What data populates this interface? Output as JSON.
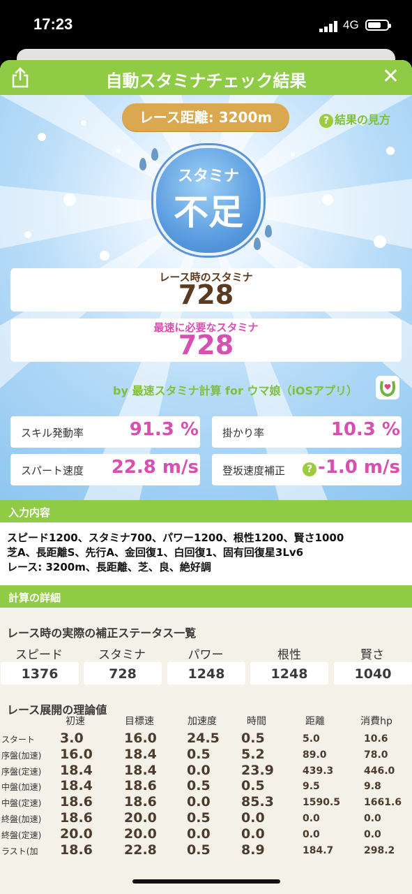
{
  "status_bar": {
    "time": "17:23",
    "network": "4G"
  },
  "header": {
    "title": "自動スタミナチェック結果",
    "share_icon": "share-icon",
    "close_icon": "close-icon",
    "close_glyph": "✕"
  },
  "race_distance": "レース距離: 3200m",
  "help_link": {
    "icon": "?",
    "label": "結果の見方"
  },
  "verdict": {
    "sub": "スタミナ",
    "main": "不足"
  },
  "race_stamina": {
    "label": "レース時のスタミナ",
    "value": "728"
  },
  "required_stamina": {
    "label": "最速に必要なスタミナ",
    "value": "728"
  },
  "credit": "by 最速スタミナ計算 for ウマ娘（iOSアプリ）",
  "metrics": {
    "skill_rate": {
      "label": "スキル発動率",
      "value": "91.3 %"
    },
    "kakari_rate": {
      "label": "掛かり率",
      "value": "10.3 %"
    },
    "spurt_speed": {
      "label": "スパート速度",
      "value": "22.8 m/s"
    },
    "slope_correction": {
      "label": "登坂速度補正",
      "value": "-1.0 m/s",
      "help": "?"
    }
  },
  "input_section": {
    "title": "入力内容",
    "lines": [
      "スピード1200、スタミナ700、パワー1200、根性1200、賢さ1000",
      "芝A、長距離S、先行A、金回復1、白回復1、固有回復星3Lv6",
      "レース: 3200m、長距離、芝、良、絶好調"
    ]
  },
  "details_section": {
    "title": "計算の詳細",
    "corrected_title": "レース時の実際の補正ステータス一覧",
    "stats": [
      {
        "label": "スピード",
        "value": "1376"
      },
      {
        "label": "スタミナ",
        "value": "728"
      },
      {
        "label": "パワー",
        "value": "1248"
      },
      {
        "label": "根性",
        "value": "1248"
      },
      {
        "label": "賢さ",
        "value": "1040"
      }
    ],
    "theory_title": "レース展開の理論値",
    "columns": [
      "初速",
      "目標速",
      "加速度",
      "時間",
      "距離",
      "消費hp"
    ],
    "rows": [
      {
        "label": "スタート",
        "values": [
          "3.0",
          "16.0",
          "24.5",
          "0.5",
          "5.0",
          "10.6"
        ]
      },
      {
        "label": "序盤(加速)",
        "values": [
          "16.0",
          "18.4",
          "0.5",
          "5.2",
          "89.0",
          "78.0"
        ]
      },
      {
        "label": "序盤(定速)",
        "values": [
          "18.4",
          "18.4",
          "0.0",
          "23.9",
          "439.3",
          "446.0"
        ]
      },
      {
        "label": "中盤(加速)",
        "values": [
          "18.4",
          "18.6",
          "0.5",
          "0.5",
          "9.5",
          "9.8"
        ]
      },
      {
        "label": "中盤(定速)",
        "values": [
          "18.6",
          "18.6",
          "0.0",
          "85.3",
          "1590.5",
          "1661.6"
        ]
      },
      {
        "label": "終盤(加速)",
        "values": [
          "18.6",
          "20.0",
          "0.5",
          "0.0",
          "0.0",
          "0.0"
        ]
      },
      {
        "label": "終盤(定速)",
        "values": [
          "20.0",
          "20.0",
          "0.0",
          "0.0",
          "0.0",
          "0.0"
        ]
      },
      {
        "label": "ラスト(加",
        "values": [
          "18.6",
          "22.8",
          "0.5",
          "8.9",
          "184.7",
          "298.2"
        ]
      }
    ]
  },
  "colors": {
    "green": "#8fcb45",
    "pink": "#d84fb2",
    "brown": "#5a3a20",
    "gold": "#d9a84f"
  }
}
